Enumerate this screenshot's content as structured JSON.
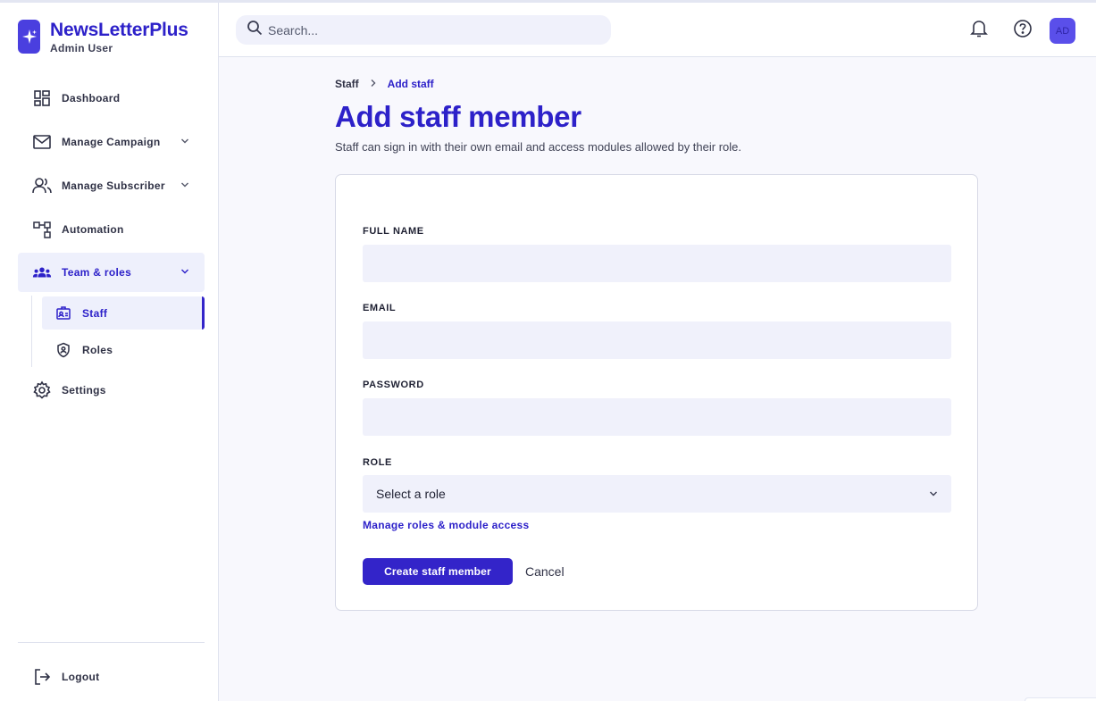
{
  "brand": {
    "name": "NewsLetterPlus",
    "subtitle": "Admin User",
    "logo_icon": "sparkle-icon"
  },
  "sidebar": {
    "items": [
      {
        "label": "Dashboard",
        "icon": "dashboard-icon"
      },
      {
        "label": "Manage Campaign",
        "icon": "mail-icon",
        "has_chevron": true
      },
      {
        "label": "Manage Subscriber",
        "icon": "users-icon",
        "has_chevron": true
      },
      {
        "label": "Automation",
        "icon": "flow-icon"
      },
      {
        "label": "Team & roles",
        "icon": "team-icon",
        "has_chevron": true,
        "active": true
      },
      {
        "label": "Settings",
        "icon": "gear-icon"
      }
    ],
    "sub_items": [
      {
        "label": "Staff",
        "icon": "id-card-icon",
        "active": true
      },
      {
        "label": "Roles",
        "icon": "shield-icon"
      }
    ],
    "logout_label": "Logout"
  },
  "topbar": {
    "search_placeholder": "Search...",
    "avatar_initials": "AD"
  },
  "breadcrumb": {
    "parent": "Staff",
    "current": "Add staff"
  },
  "page": {
    "title": "Add staff member",
    "description": "Staff can sign in with their own email and access modules allowed by their role."
  },
  "form": {
    "full_name_label": "FULL NAME",
    "full_name_value": "",
    "email_label": "EMAIL",
    "email_value": "",
    "password_label": "PASSWORD",
    "password_value": "",
    "role_label": "ROLE",
    "role_selected": "Select a role",
    "manage_roles_link": "Manage roles & module access",
    "submit_label": "Create staff member",
    "cancel_label": "Cancel"
  },
  "colors": {
    "accent": "#2d21c9",
    "button": "#3324c9",
    "input_bg": "#f0f1fb",
    "active_bg": "#eef0fc"
  }
}
